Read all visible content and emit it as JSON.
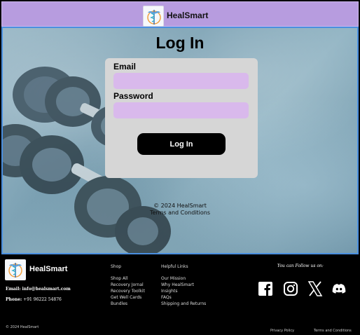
{
  "header": {
    "brand": "HealSmart",
    "logo_icon": "caduceus-logo-icon"
  },
  "login": {
    "heading": "Log In",
    "email_label": "Email",
    "email_value": "",
    "email_placeholder": "",
    "password_label": "Password",
    "password_value": "",
    "password_placeholder": "",
    "submit_label": "Log In"
  },
  "hero_footer": {
    "copyright": "© 2024 HealSmart",
    "terms": "Terms and Conditions"
  },
  "footer": {
    "brand": "HealSmart",
    "email_label": "Email:",
    "email": "info@healsmart.com",
    "phone_label": "Phone:",
    "phone": "+91 96222 54876",
    "shop": {
      "title": "Shop",
      "items": [
        "Shop All",
        "Recovery Jornal",
        "Recovery Toolkit",
        "Get Well Cards",
        "Bundles"
      ]
    },
    "help": {
      "title": "Helpful Links",
      "items": [
        "Our Mission",
        "Why HealSmart",
        "Insights",
        "FAQs",
        "Shipping and Returns"
      ]
    },
    "follow_title": "You can Follow us on:",
    "social": [
      "facebook-icon",
      "instagram-icon",
      "x-icon",
      "discord-icon"
    ],
    "copyright": "© 2024 HealSmart",
    "privacy": "Privacy Policy",
    "terms": "Terms and Conditions"
  },
  "colors": {
    "header_bg": "#b79cdf",
    "input_bg": "#d9b9ec",
    "card_bg": "#d6d6d6",
    "button_bg": "#000000",
    "hero_border": "#4a8fe0",
    "footer_bg": "#000000"
  }
}
